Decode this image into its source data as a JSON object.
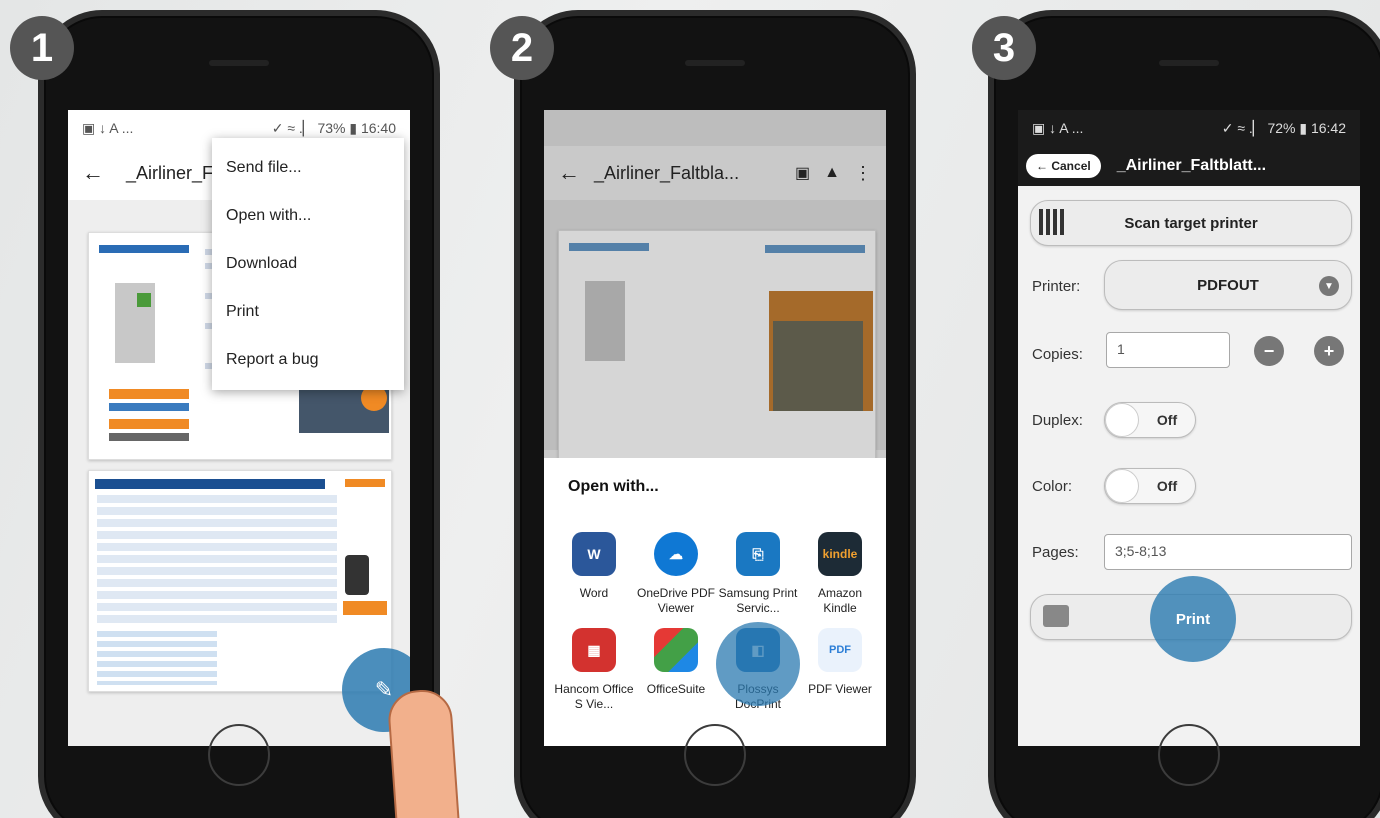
{
  "steps": [
    "1",
    "2",
    "3"
  ],
  "phone1": {
    "status_left": "▣ ↓ A ...",
    "status_right": "✓ ≈ .▏ 73% ▮ 16:40",
    "title": "_Airliner_Fa",
    "menu": [
      "Send file...",
      "Open with...",
      "Download",
      "Print",
      "Report a bug"
    ]
  },
  "phone2": {
    "title": "_Airliner_Faltbla...",
    "sheet_title": "Open with...",
    "apps": [
      {
        "label": "Word",
        "color": "#2b579a",
        "icon": "word-icon"
      },
      {
        "label": "OneDrive PDF Viewer",
        "color": "#0f78d4",
        "icon": "onedrive-icon"
      },
      {
        "label": "Samsung Print Servic...",
        "color": "#1a78c2",
        "icon": "samsung-print-icon"
      },
      {
        "label": "Amazon Kindle",
        "color": "#1d2b36",
        "icon": "kindle-icon"
      },
      {
        "label": "Hancom Office S Vie...",
        "color": "#d3322f",
        "icon": "hancom-icon"
      },
      {
        "label": "OfficeSuite",
        "color": "#e53935",
        "icon": "officesuite-icon"
      },
      {
        "label": "Plossys DocPrint",
        "color": "#1d6fb8",
        "icon": "plossys-icon"
      },
      {
        "label": "PDF Viewer",
        "color": "#2c7ed6",
        "icon": "pdf-viewer-icon"
      }
    ],
    "kindle_text": "kindle",
    "word_text": "W",
    "pdf_text": "PDF"
  },
  "phone3": {
    "status_left": "▣ ↓ A ...",
    "status_right": "✓ ≈ .▏ 72% ▮ 16:42",
    "cancel_label": "Cancel",
    "title": "_Airliner_Faltblatt...",
    "scan_label": "Scan target printer",
    "printer_label": "Printer:",
    "printer_value": "PDFOUT",
    "copies_label": "Copies:",
    "copies_value": "1",
    "duplex_label": "Duplex:",
    "duplex_value": "Off",
    "color_label": "Color:",
    "color_value": "Off",
    "pages_label": "Pages:",
    "pages_value": "3;5-8;13",
    "print_label": "Print"
  }
}
